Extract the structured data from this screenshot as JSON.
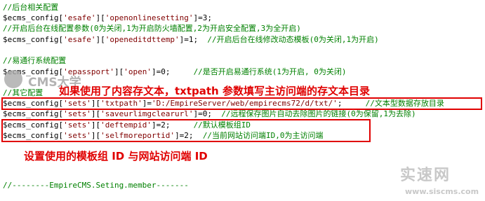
{
  "code": {
    "lines": [
      {
        "cm": "//后台相关配置"
      },
      {
        "pre": "$ecms_config[",
        "s1": "'esafe'",
        "mid": "][",
        "s2": "'openonlinesetting'",
        "post": "]=3;"
      },
      {
        "cm": "//开启后台在线配置参数(0为关闭,1为开启防火墙配置,2为开启安全配置,3为全开启)"
      },
      {
        "pre": "$ecms_config[",
        "s1": "'esafe'",
        "mid": "][",
        "s2": "'openeditdttemp'",
        "post": "]=1;  ",
        "cm": "//开启后台在线修改动态模板(0为关闭,1为开启)"
      },
      {
        "cm": "//易通行系统配置"
      },
      {
        "pre": "$ecms_config[",
        "s1": "'epassport'",
        "mid": "][",
        "s2": "'open'",
        "post": "]=0;     ",
        "cm": "//是否开启易通行系统(1为开启, 0为关闭)"
      },
      {
        "cm": "//其它配置"
      },
      {
        "pre": "$ecms_config[",
        "s1": "'sets'",
        "mid": "][",
        "s2": "'txtpath'",
        "post": "]=",
        "s3": "'D:/EmpireServer/web/empirecms72/d/txt/'",
        "post2": ";     ",
        "cm": "//文本型数据存放目录"
      },
      {
        "pre": "$ecms_config[",
        "s1": "'sets'",
        "mid": "][",
        "s2": "'saveurlimgclearurl'",
        "post": "]=0;  ",
        "cm": "//远程保存图片自动去除图片的链接(0为保留,1为去除)"
      },
      {
        "pre": "$ecms_config[",
        "s1": "'sets'",
        "mid": "][",
        "s2": "'deftempid'",
        "post": "]=2;     ",
        "cm": "//默认模板组ID"
      },
      {
        "pre": "$ecms_config[",
        "s1": "'sets'",
        "mid": "][",
        "s2": "'selfmoreportid'",
        "post": "]=2;  ",
        "cm": "//当前网站访问端ID,0为主访问端"
      },
      {
        "cm": "//--------EmpireCMS.Seting.member-------"
      }
    ]
  },
  "annotations": {
    "top": "如果使用了内容存文本，txtpath 参数填写主访问端的存文本目录",
    "bottom": "设置使用的模板组 ID 与网站访问端 ID"
  },
  "watermark": {
    "text": "CMS大学",
    "brand_cn": "实速网",
    "brand_url": "www.siscms.com"
  },
  "colors": {
    "annotation": "#e00000",
    "comment": "#008000",
    "string": "#800000"
  }
}
